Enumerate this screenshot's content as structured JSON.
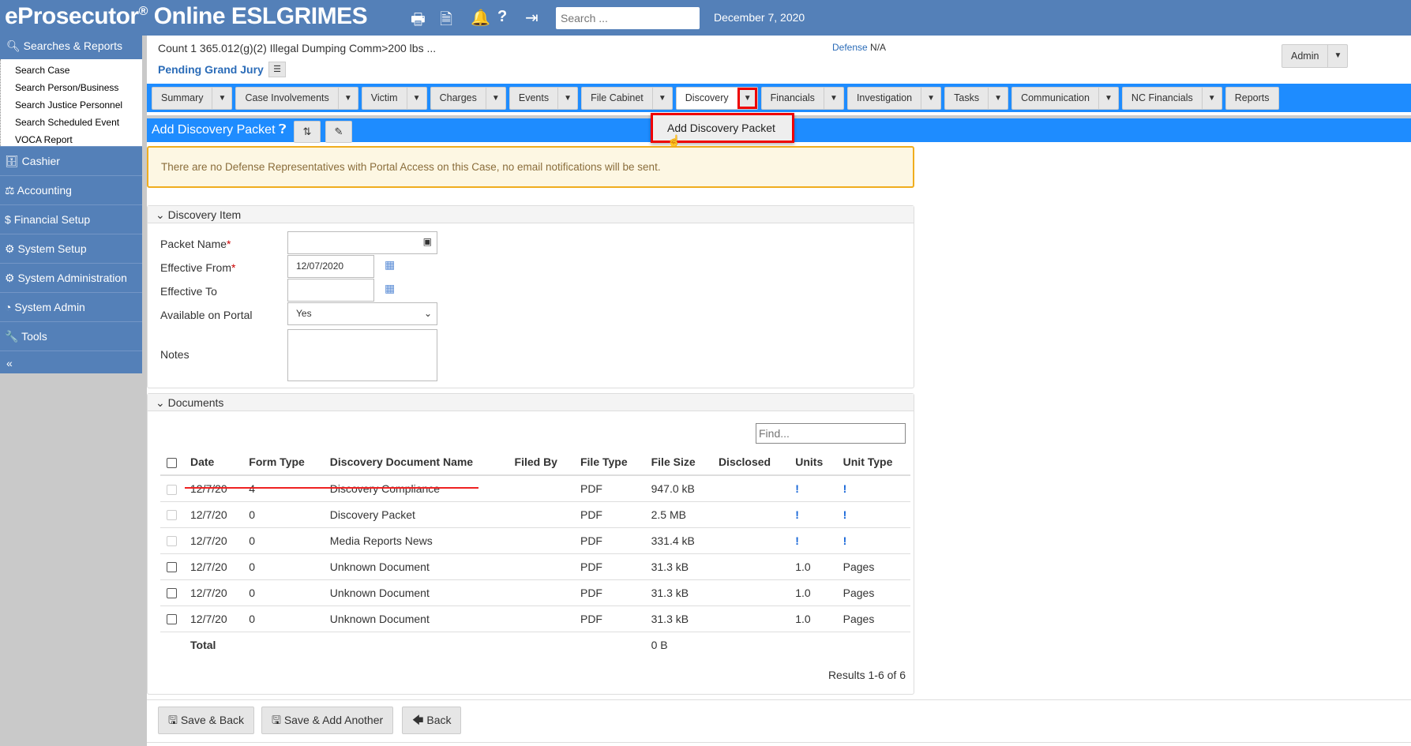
{
  "header": {
    "brand": "eProsecutor",
    "brand_suffix": "Online ESLGRIMES",
    "search_placeholder": "Search ...",
    "date": "December 7, 2020",
    "icons": [
      "printer-icon",
      "document-icon",
      "bell-icon",
      "help-icon",
      "logout-icon"
    ]
  },
  "sidebar": {
    "section": "Searches & Reports",
    "subitems": [
      "Search Case",
      "Search Person/Business",
      "Search Justice Personnel",
      "Search Scheduled Event",
      "VOCA Report"
    ],
    "items": [
      {
        "label": "Cashier",
        "icon": "cashier-icon"
      },
      {
        "label": "Accounting",
        "icon": "accounting-icon"
      },
      {
        "label": "Financial Setup",
        "icon": "dollar-icon"
      },
      {
        "label": "System Setup",
        "icon": "gears-icon"
      },
      {
        "label": "System Administration",
        "icon": "gears-icon"
      },
      {
        "label": "System Admin",
        "icon": "dashboard-icon"
      },
      {
        "label": "Tools",
        "icon": "wrench-icon"
      }
    ],
    "collapse": "«"
  },
  "case": {
    "count": "Count 1 365.012(g)(2) Illegal Dumping Comm>200 lbs ...",
    "status": "Pending Grand Jury",
    "defense_label": "Defense",
    "defense_value": "N/A",
    "user": "Admin"
  },
  "tabs": [
    {
      "label": "Summary",
      "dd": true
    },
    {
      "label": "Case Involvements",
      "dd": true
    },
    {
      "label": "Victim",
      "dd": true
    },
    {
      "label": "Charges",
      "dd": true
    },
    {
      "label": "Events",
      "dd": true
    },
    {
      "label": "File Cabinet",
      "dd": true
    },
    {
      "label": "Discovery",
      "dd": true,
      "active": true
    },
    {
      "label": "Financials",
      "dd": true
    },
    {
      "label": "Investigation",
      "dd": true
    },
    {
      "label": "Tasks",
      "dd": true
    },
    {
      "label": "Communication",
      "dd": true
    },
    {
      "label": "NC Financials",
      "dd": true
    },
    {
      "label": "Reports",
      "dd": false
    }
  ],
  "dropdown": {
    "item": "Add Discovery Packet"
  },
  "page": {
    "title": "Add Discovery Packet",
    "alert": "There are no Defense Representatives with Portal Access on this Case, no email notifications will be sent."
  },
  "form": {
    "section": "Discovery Item",
    "packet_name_label": "Packet Name",
    "packet_name": "",
    "effective_from_label": "Effective From",
    "effective_from": "12/07/2020",
    "effective_to_label": "Effective To",
    "effective_to": "",
    "portal_label": "Available on Portal",
    "portal_value": "Yes",
    "notes_label": "Notes",
    "required": "*"
  },
  "documents": {
    "section": "Documents",
    "find_placeholder": "Find...",
    "columns": [
      "Date",
      "Form Type",
      "Discovery Document Name",
      "Filed By",
      "File Type",
      "File Size",
      "Disclosed",
      "Units",
      "Unit Type"
    ],
    "rows": [
      {
        "date": "12/7/20",
        "form": "4",
        "name": "Discovery Compliance",
        "filed": "",
        "type": "PDF",
        "size": "947.0 kB",
        "disclosed": "",
        "units": "!",
        "unit_type": "!",
        "disabled": true
      },
      {
        "date": "12/7/20",
        "form": "0",
        "name": "Discovery Packet",
        "filed": "",
        "type": "PDF",
        "size": "2.5 MB",
        "disclosed": "",
        "units": "!",
        "unit_type": "!",
        "disabled": true
      },
      {
        "date": "12/7/20",
        "form": "0",
        "name": "Media Reports News",
        "filed": "",
        "type": "PDF",
        "size": "331.4 kB",
        "disclosed": "",
        "units": "!",
        "unit_type": "!",
        "disabled": true
      },
      {
        "date": "12/7/20",
        "form": "0",
        "name": "Unknown Document",
        "filed": "",
        "type": "PDF",
        "size": "31.3 kB",
        "disclosed": "",
        "units": "1.0",
        "unit_type": "Pages",
        "disabled": false
      },
      {
        "date": "12/7/20",
        "form": "0",
        "name": "Unknown Document",
        "filed": "",
        "type": "PDF",
        "size": "31.3 kB",
        "disclosed": "",
        "units": "1.0",
        "unit_type": "Pages",
        "disabled": false
      },
      {
        "date": "12/7/20",
        "form": "0",
        "name": "Unknown Document",
        "filed": "",
        "type": "PDF",
        "size": "31.3 kB",
        "disclosed": "",
        "units": "1.0",
        "unit_type": "Pages",
        "disabled": false
      }
    ],
    "total_label": "Total",
    "total_size": "0 B",
    "results": "Results 1-6 of 6"
  },
  "footer": {
    "save_back": "Save & Back",
    "save_add": "Save & Add Another",
    "back": "Back"
  }
}
